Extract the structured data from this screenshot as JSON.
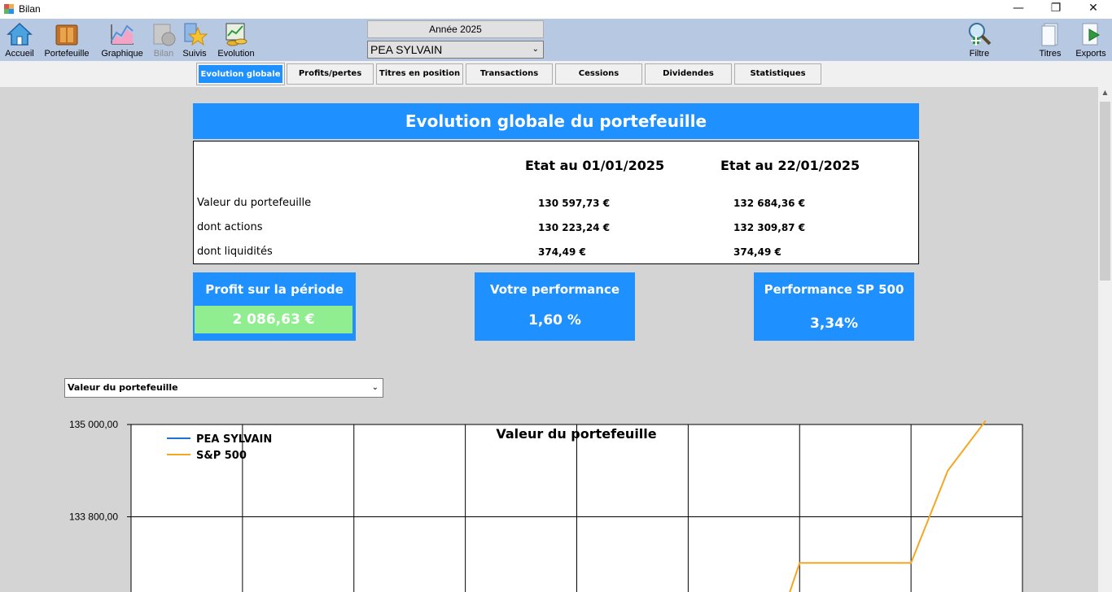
{
  "window": {
    "title": "Bilan",
    "minimize": "—",
    "restore": "❐",
    "close": "✕"
  },
  "toolbar": {
    "left_buttons": [
      {
        "label": "Accueil",
        "icon": "home-icon"
      },
      {
        "label": "Portefeuille",
        "icon": "portfolio-icon"
      },
      {
        "label": "Graphique",
        "icon": "chart-icon"
      },
      {
        "label": "Bilan",
        "icon": "balance-icon",
        "disabled": true
      },
      {
        "label": "Suivis",
        "icon": "star-icon"
      },
      {
        "label": "Evolution",
        "icon": "evolution-icon"
      }
    ],
    "right_buttons": [
      {
        "label": "Filtre",
        "icon": "filter-icon"
      },
      {
        "label": "Titres",
        "icon": "document-icon"
      },
      {
        "label": "Exports",
        "icon": "export-icon"
      }
    ],
    "year_label": "Année 2025",
    "portfolio_selected": "PEA SYLVAIN"
  },
  "tabs": [
    {
      "label": "Evolution globale",
      "active": true
    },
    {
      "label": "Profits/pertes"
    },
    {
      "label": "Titres en position"
    },
    {
      "label": "Transactions"
    },
    {
      "label": "Cessions"
    },
    {
      "label": "Dividendes"
    },
    {
      "label": "Statistiques"
    }
  ],
  "summary": {
    "title": "Evolution globale du portefeuille",
    "col1_header": "Etat au 01/01/2025",
    "col2_header": "Etat au 22/01/2025",
    "rows": [
      {
        "label": "Valeur du portefeuille",
        "v1": "130 597,73 €",
        "v2": "132 684,36 €"
      },
      {
        "label": "dont actions",
        "v1": "130 223,24 €",
        "v2": "132 309,87 €"
      },
      {
        "label": "dont liquidités",
        "v1": "374,49 €",
        "v2": "374,49 €"
      }
    ]
  },
  "kpis": {
    "profit": {
      "title": "Profit sur la période",
      "value": "2 086,63 €"
    },
    "performance": {
      "title": "Votre performance",
      "value": "1,60 %"
    },
    "sp500": {
      "title": "Performance SP 500",
      "value": "3,34%"
    }
  },
  "chart_selector": {
    "selected": "Valeur du portefeuille"
  },
  "colors": {
    "accent": "#1e90ff",
    "profit_green": "#90ee90",
    "toolbar": "#b7c9e2",
    "series_sp500": "#f5a623",
    "series_pea": "#1e73d2"
  },
  "chart_data": {
    "type": "line",
    "title": "Valeur du portefeuille",
    "ytick_labels": [
      "135 000,00",
      "133 800,00"
    ],
    "y_ticks": [
      135000,
      133800
    ],
    "ylim_visible": [
      131600,
      135000
    ],
    "x_slots": 8,
    "series": [
      {
        "name": "PEA SYLVAIN",
        "color": "#1e73d2",
        "x": [],
        "y": []
      },
      {
        "name": "S&P 500",
        "color": "#f5a623",
        "x": [
          5.86,
          6.0,
          7.0,
          7.33,
          7.67
        ],
        "y": [
          132600,
          133200,
          133200,
          134400,
          135050
        ]
      }
    ],
    "legend": "top-left"
  }
}
